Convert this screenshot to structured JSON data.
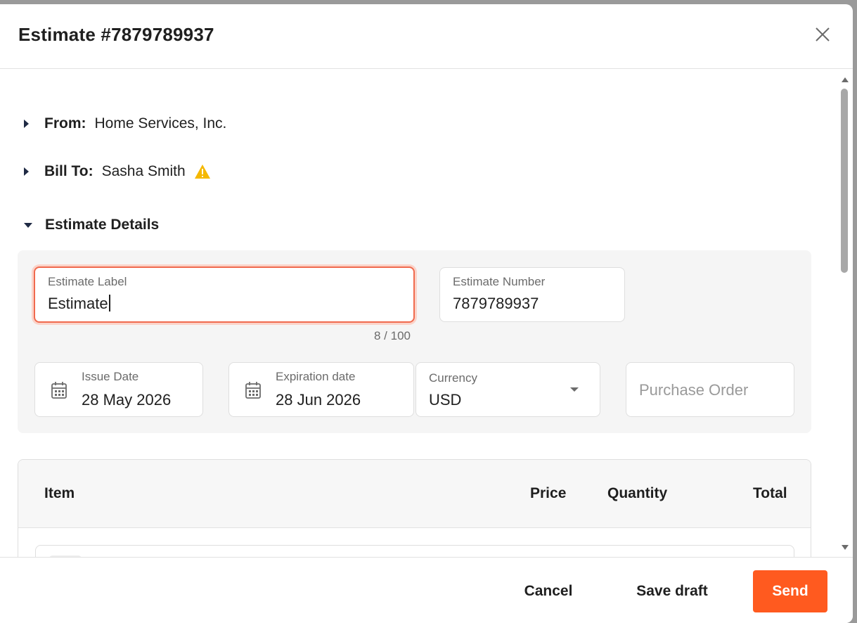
{
  "header": {
    "title": "Estimate #7879789937"
  },
  "sections": {
    "from": {
      "label": "From:",
      "value": "Home Services, Inc."
    },
    "bill_to": {
      "label": "Bill To:",
      "value": "Sasha Smith"
    },
    "estimate_details": {
      "label": "Estimate Details"
    }
  },
  "fields": {
    "estimate_label": {
      "label": "Estimate Label",
      "value": "Estimate",
      "counter": "8 / 100"
    },
    "estimate_number": {
      "label": "Estimate Number",
      "value": "7879789937"
    },
    "issue_date": {
      "label": "Issue Date",
      "value": "28 May 2026"
    },
    "expiration_date": {
      "label": "Expiration date",
      "value": "28 Jun 2026"
    },
    "currency": {
      "label": "Currency",
      "value": "USD"
    },
    "purchase_order": {
      "placeholder": "Purchase Order"
    }
  },
  "table": {
    "columns": [
      "Item",
      "Price",
      "Quantity",
      "Total"
    ]
  },
  "footer": {
    "cancel_label": "Cancel",
    "save_draft_label": "Save draft",
    "send_label": "Send"
  },
  "colors": {
    "accent": "#ff5a1f",
    "focus_border": "#f06a4e",
    "warning": "#f5b800"
  },
  "icons": {
    "close": "close-icon",
    "warning": "warning-icon",
    "calendar": "calendar-icon",
    "dropdown": "chevron-down-icon"
  }
}
